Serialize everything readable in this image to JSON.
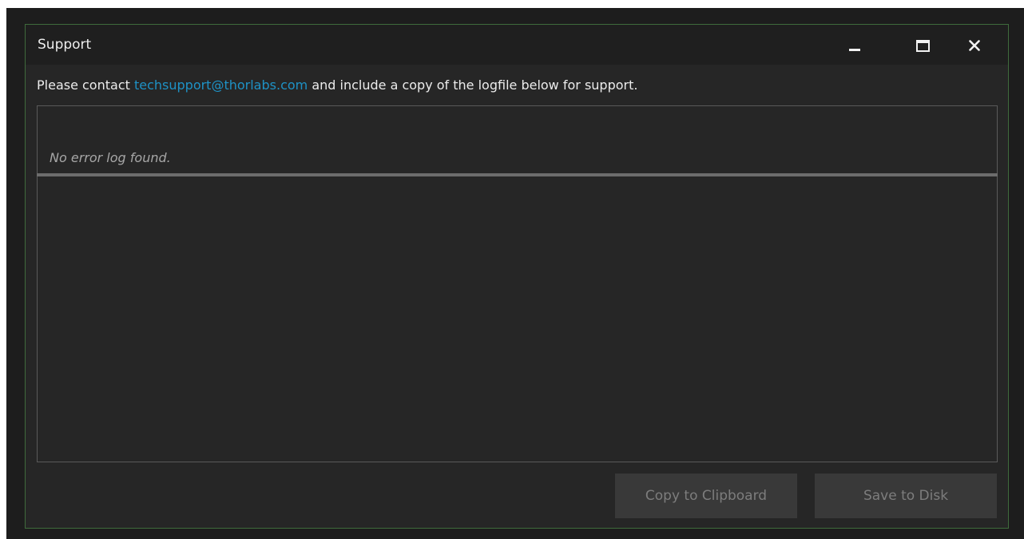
{
  "window": {
    "title": "Support",
    "controls": {
      "minimize": "minimize-icon",
      "maximize": "maximize-icon",
      "close": "close-icon",
      "close_glyph": "✕"
    }
  },
  "contact": {
    "prefix": "Please contact ",
    "email": "techsupport@thorlabs.com",
    "suffix": " and include a copy of the logfile below for support."
  },
  "log": {
    "header_message": "No error log found.",
    "content": ""
  },
  "buttons": {
    "copy_label": "Copy to Clipboard",
    "save_label": "Save to Disk"
  },
  "colors": {
    "background": "#262626",
    "titlebar": "#1f1f1f",
    "border_accent": "#3f6b3c",
    "link": "#1e92c6",
    "button_bg": "#393939",
    "button_text_disabled": "#7d7d7d"
  }
}
